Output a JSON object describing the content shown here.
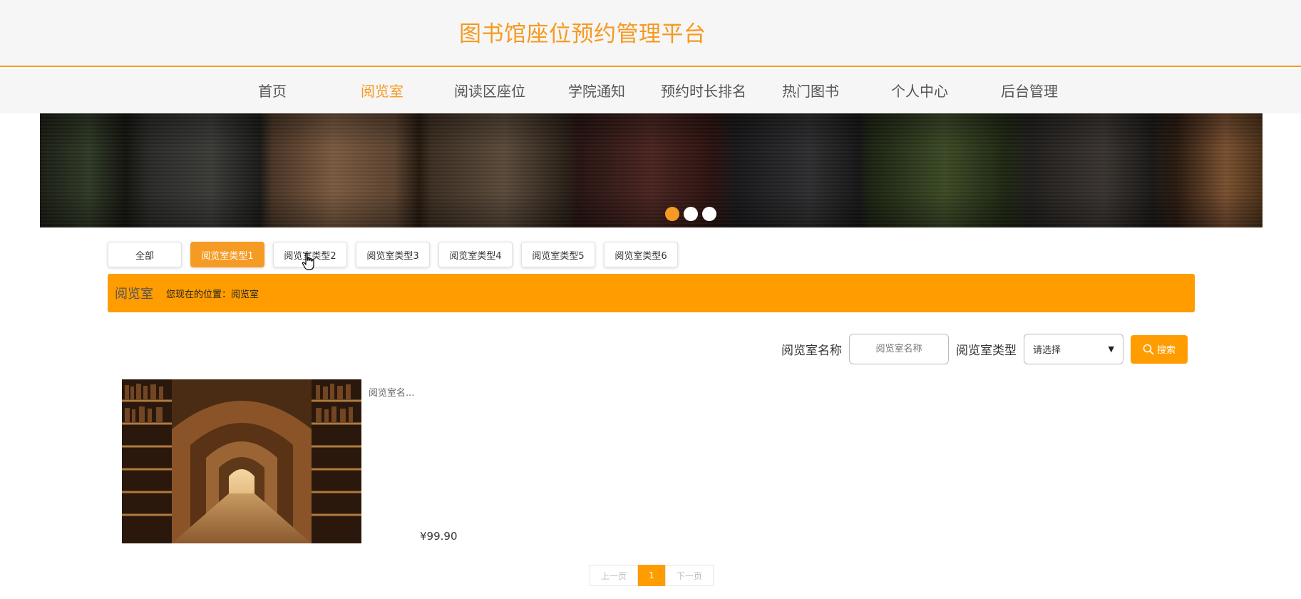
{
  "header": {
    "title": "图书馆座位预约管理平台"
  },
  "nav": {
    "items": [
      {
        "label": "首页",
        "active": false
      },
      {
        "label": "阅览室",
        "active": true
      },
      {
        "label": "阅读区座位",
        "active": false
      },
      {
        "label": "学院通知",
        "active": false
      },
      {
        "label": "预约时长排名",
        "active": false
      },
      {
        "label": "热门图书",
        "active": false
      },
      {
        "label": "个人中心",
        "active": false
      },
      {
        "label": "后台管理",
        "active": false
      }
    ]
  },
  "banner": {
    "dots": 3,
    "active_dot": 0
  },
  "categories": [
    {
      "label": "全部",
      "active": false
    },
    {
      "label": "阅览室类型1",
      "active": true
    },
    {
      "label": "阅览室类型2",
      "active": false
    },
    {
      "label": "阅览室类型3",
      "active": false
    },
    {
      "label": "阅览室类型4",
      "active": false
    },
    {
      "label": "阅览室类型5",
      "active": false
    },
    {
      "label": "阅览室类型6",
      "active": false
    }
  ],
  "location": {
    "title": "阅览室",
    "text": "您现在的位置：阅览室"
  },
  "search": {
    "name_label": "阅览室名称",
    "name_placeholder": "阅览室名称",
    "type_label": "阅览室类型",
    "type_selected": "请选择",
    "button_label": "搜索"
  },
  "items": [
    {
      "name": "阅览室名...",
      "price": "¥99.90"
    }
  ],
  "pagination": {
    "prev": "上一页",
    "current": "1",
    "next": "下一页"
  },
  "colors": {
    "accent": "#f59a23",
    "bar": "#ff9c00"
  }
}
